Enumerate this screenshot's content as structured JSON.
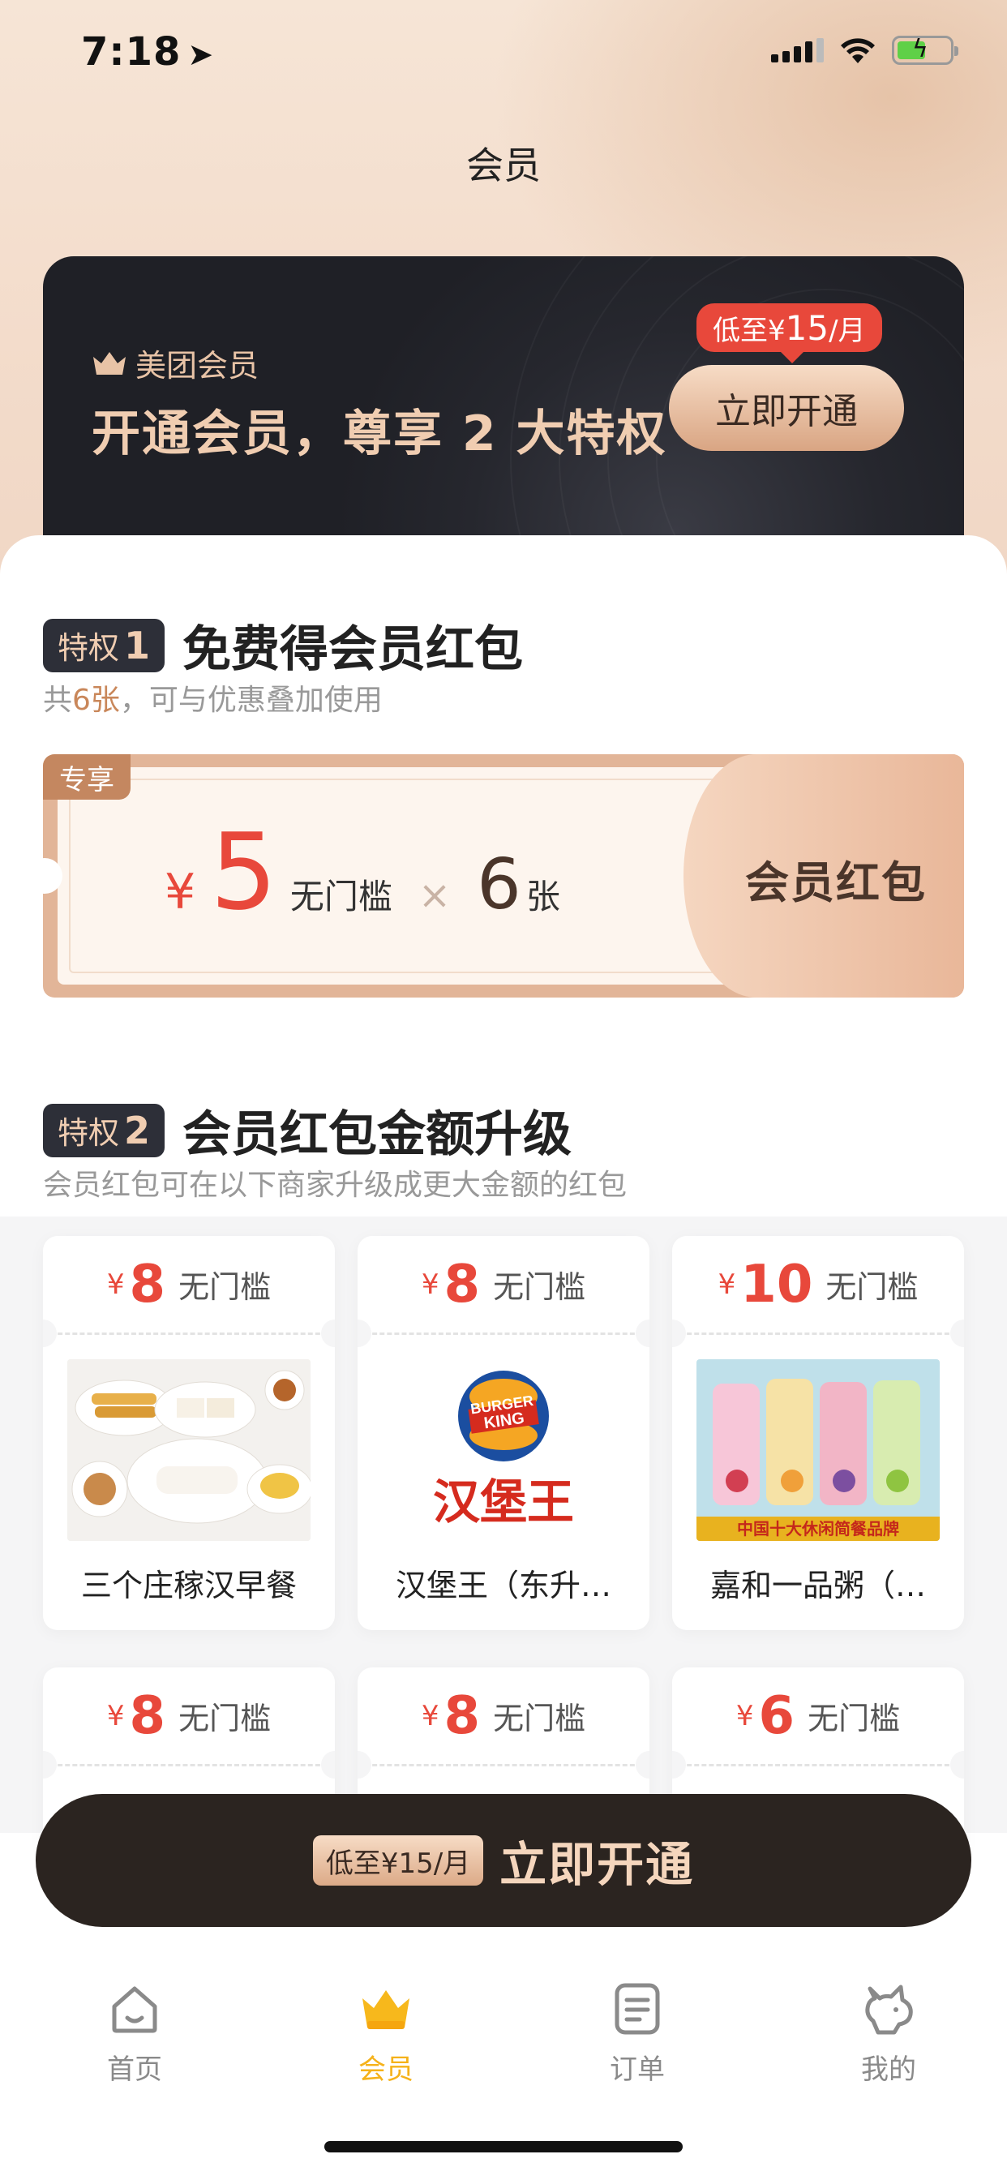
{
  "status_bar": {
    "time": "7:18",
    "location_icon": "location-arrow-icon",
    "battery_charging": true
  },
  "header": {
    "title": "会员"
  },
  "promo": {
    "brand": "美团会员",
    "headline": "开通会员，尊享 2 大特权",
    "price_tag_prefix": "低至¥",
    "price_tag_amount": "15",
    "price_tag_suffix": "/月",
    "button_label": "立即开通"
  },
  "privilege1": {
    "tag_label": "特权",
    "tag_num": "1",
    "title": "免费得会员红包",
    "subtitle_prefix": "共",
    "subtitle_highlight": "6张",
    "subtitle_suffix": "，可与优惠叠加使用",
    "coupon": {
      "exclusive_tag": "专享",
      "currency": "¥",
      "amount": "5",
      "condition": "无门槛",
      "times": "×",
      "quantity": "6",
      "unit": "张",
      "label": "会员红包"
    }
  },
  "privilege2": {
    "tag_label": "特权",
    "tag_num": "2",
    "title": "会员红包金额升级",
    "subtitle": "会员红包可在以下商家升级成更大金额的红包",
    "merchants": [
      {
        "currency": "¥",
        "amount": "8",
        "condition": "无门槛",
        "name": "三个庄稼汉早餐",
        "image": "breakfast-food-photo"
      },
      {
        "currency": "¥",
        "amount": "8",
        "condition": "无门槛",
        "name": "汉堡王（东升…",
        "image": "burger-king-logo",
        "logo_text_top": "BURGER",
        "logo_text_bottom": "KING",
        "logo_cn": "汉堡王"
      },
      {
        "currency": "¥",
        "amount": "10",
        "condition": "无门槛",
        "name": "嘉和一品粥（…",
        "image": "drinks-promo-photo",
        "banner_text": "中国十大休闲简餐品牌"
      },
      {
        "currency": "¥",
        "amount": "8",
        "condition": "无门槛"
      },
      {
        "currency": "¥",
        "amount": "8",
        "condition": "无门槛"
      },
      {
        "currency": "¥",
        "amount": "6",
        "condition": "无门槛"
      }
    ]
  },
  "cta": {
    "tag": "低至¥15/月",
    "label": "立即开通"
  },
  "tabs": [
    {
      "label": "首页",
      "icon": "home-icon",
      "active": false
    },
    {
      "label": "会员",
      "icon": "crown-icon",
      "active": true
    },
    {
      "label": "订单",
      "icon": "order-list-icon",
      "active": false
    },
    {
      "label": "我的",
      "icon": "profile-kangaroo-icon",
      "active": false
    }
  ],
  "colors": {
    "accent_red": "#e8483b",
    "gold": "#f0cdb1",
    "dark_card": "#26272e",
    "tab_active": "#f5b21a"
  }
}
